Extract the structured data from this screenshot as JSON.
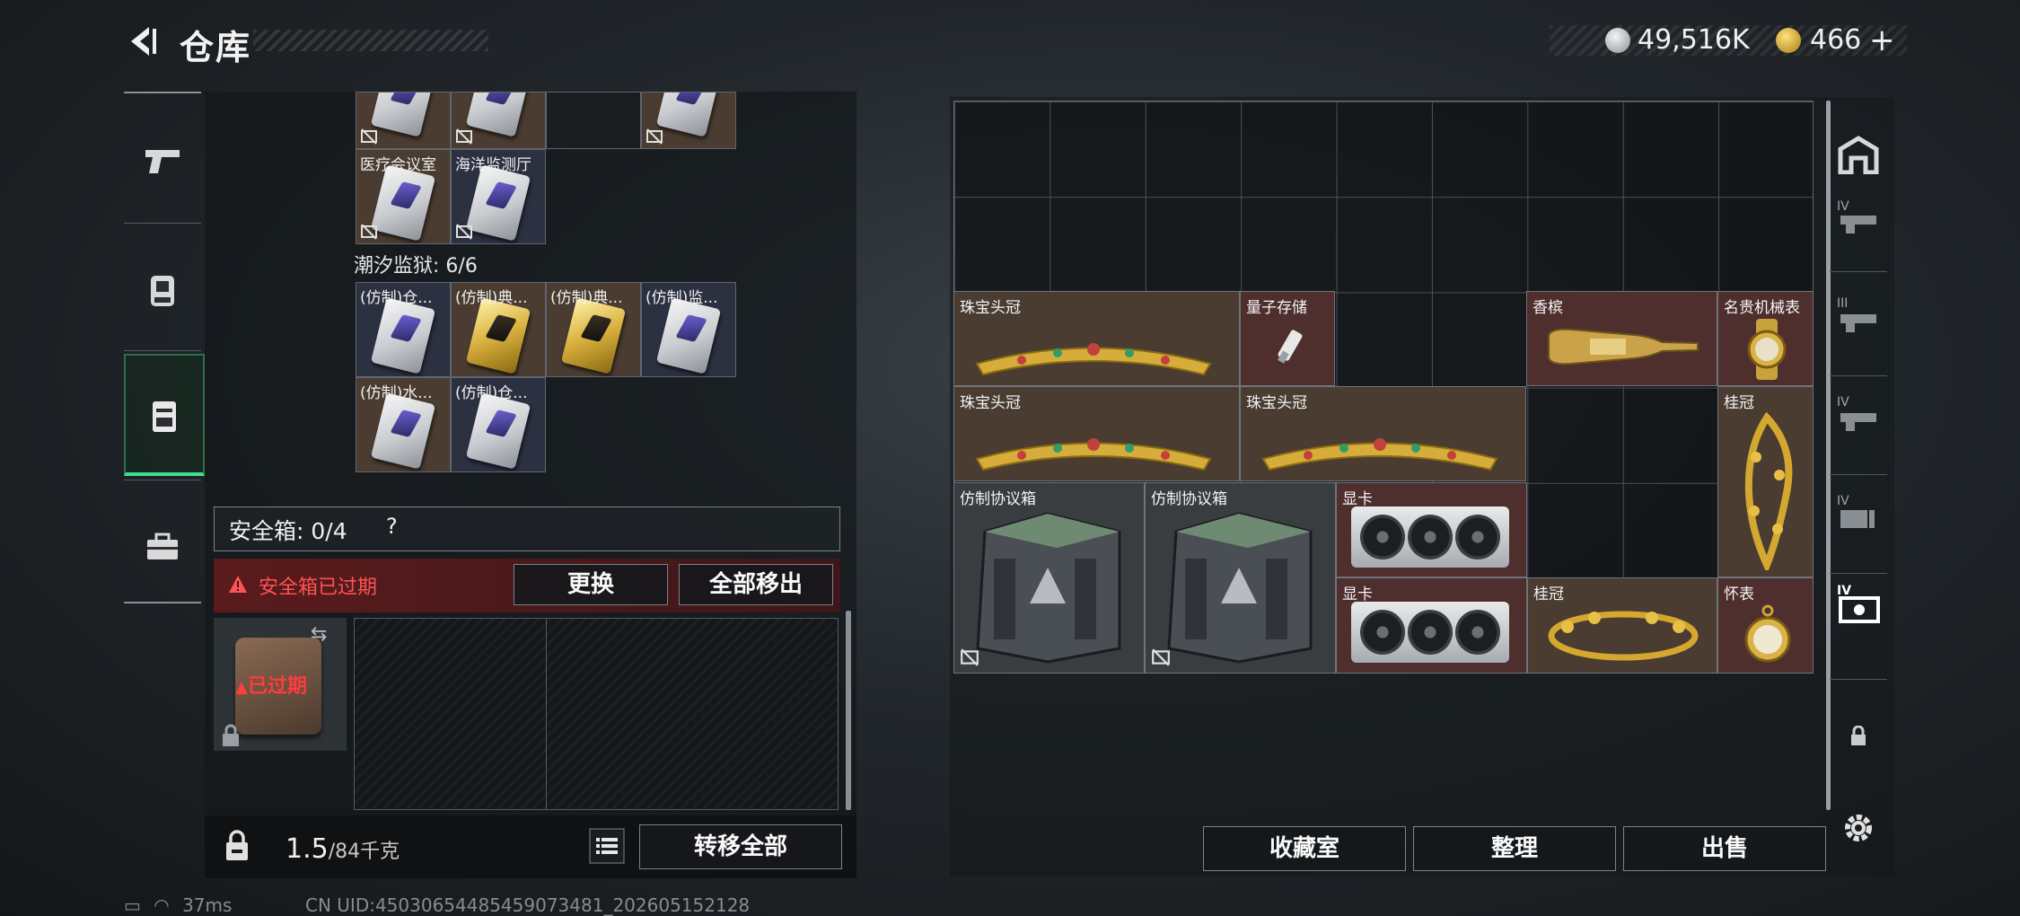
{
  "header": {
    "title": "仓库",
    "currency_main": "49,516K",
    "currency_premium": "466"
  },
  "left_inventory": {
    "top_cells": [
      {
        "label": "医疗会议室",
        "color": "navy"
      },
      {
        "label": "海洋监测厅",
        "color": "navy"
      }
    ],
    "section_title": "潮汐监狱: 6/6",
    "section_cells": [
      {
        "label": "(仿制)仓...",
        "color": "navy"
      },
      {
        "label": "(仿制)典...",
        "color": "brown"
      },
      {
        "label": "(仿制)典...",
        "color": "brown"
      },
      {
        "label": "(仿制)监...",
        "color": "navy"
      },
      {
        "label": "(仿制)水...",
        "color": "brown"
      },
      {
        "label": "(仿制)仓...",
        "color": "navy"
      }
    ]
  },
  "safebox": {
    "label": "安全箱: 0/4",
    "help": "?",
    "expired_text": "安全箱已过期",
    "replace_label": "更换",
    "move_all_label": "全部移出",
    "expired_badge": "已过期"
  },
  "bottom_left": {
    "weight_value": "1.5",
    "weight_unit": "/84千克",
    "transfer_label": "转移全部"
  },
  "status": {
    "ping": "37ms",
    "uid": "CN UID:45030654485459073481_202605152128"
  },
  "stash_items": [
    {
      "label": "珠宝头冠",
      "icon": "tiara"
    },
    {
      "label": "量子存储",
      "icon": "usb-drive"
    },
    {
      "label": "香槟",
      "icon": "champagne-bottle"
    },
    {
      "label": "名贵机械表",
      "icon": "wristwatch"
    },
    {
      "label": "珠宝头冠",
      "icon": "tiara"
    },
    {
      "label": "珠宝头冠",
      "icon": "tiara"
    },
    {
      "label": "桂冠",
      "icon": "laurel-crown"
    },
    {
      "label": "仿制协议箱",
      "icon": "crate"
    },
    {
      "label": "仿制协议箱",
      "icon": "crate"
    },
    {
      "label": "显卡",
      "icon": "graphics-card"
    },
    {
      "label": "显卡",
      "icon": "graphics-card"
    },
    {
      "label": "桂冠",
      "icon": "laurel-crown"
    },
    {
      "label": "怀表",
      "icon": "pocket-watch"
    }
  ],
  "actions": {
    "collection_label": "收藏室",
    "sort_label": "整理",
    "sell_label": "出售"
  },
  "right_nav": {
    "tiers": [
      "IV",
      "III",
      "IV",
      "IV",
      "IV"
    ]
  },
  "colors": {
    "maroon": "#4e2f2e",
    "brown": "#4a3c30",
    "navy": "#2c3142",
    "expired_red": "#ff5252"
  }
}
